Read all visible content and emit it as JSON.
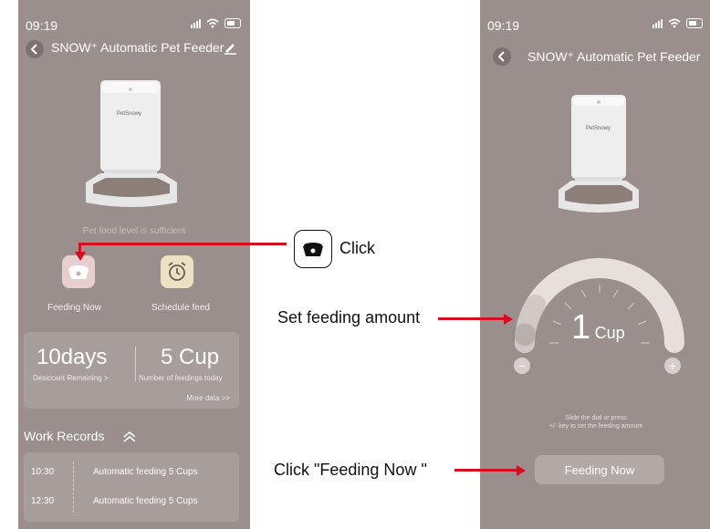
{
  "left_screen": {
    "status_time": "09:19",
    "title": "SNOW⁺ Automatic Pet Feeder",
    "feeder_brand": "PetSnowy",
    "food_status": "Pet food level is sufficient",
    "actions": {
      "feeding_now_label": "Feeding Now",
      "schedule_feed_label": "Schedule feed"
    },
    "stats": {
      "desiccant_value": "10days",
      "desiccant_label": "Desiccant Remaining >",
      "feedings_value": "5 Cup",
      "feedings_label": "Number of feedings today",
      "more_data": "More data >>"
    },
    "work_records": {
      "title": "Work Records",
      "items": [
        {
          "time": "10:30",
          "desc": "Automatic feeding 5 Cups"
        },
        {
          "time": "12:30",
          "desc": "Automatic feeding 5 Cups"
        }
      ]
    }
  },
  "right_screen": {
    "status_time": "09:19",
    "title": "SNOW⁺ Automatic Pet Feeder",
    "feeder_brand": "PetSnowy",
    "dial": {
      "amount": "1",
      "unit": "Cup"
    },
    "hint_line1": "Slide the dial or press",
    "hint_line2": "+/- key to set the feeding amount",
    "feed_button": "Feeding Now"
  },
  "annotations": {
    "click": "Click",
    "set_amount": "Set feeding amount",
    "click_feed": "Click \"Feeding Now \""
  },
  "colors": {
    "phone_bg": "#9a8f8c",
    "arrow": "#d4101f",
    "feed_tile": "#e7cfcd",
    "schedule_tile": "#ede1c4"
  },
  "icons": [
    "back-arrow-icon",
    "edit-pencil-icon",
    "food-bowl-icon",
    "alarm-clock-icon",
    "chevron-up-icon",
    "wifi-icon",
    "signal-icon",
    "battery-icon",
    "minus-icon",
    "plus-icon"
  ]
}
